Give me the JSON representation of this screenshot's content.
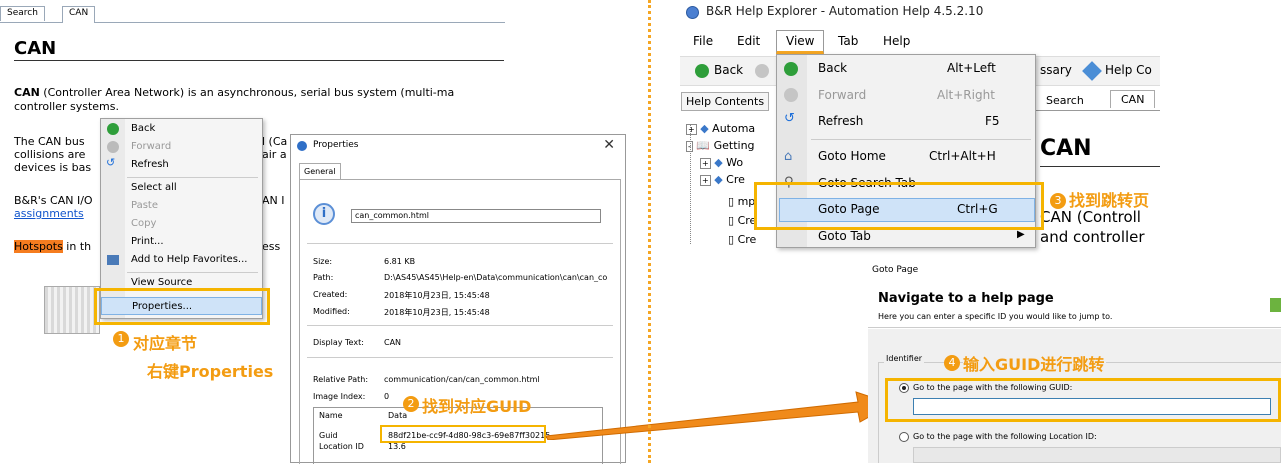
{
  "left": {
    "tabs": [
      "Search",
      "CAN"
    ],
    "heading": "CAN",
    "para1_bold": "CAN",
    "para1_rest": " (Controller Area Network) is an asynchronous, serial bus system (multi-ma",
    "para1_line2": "controller systems.",
    "para2_a": "The CAN bus",
    "para2_b": "collisions are",
    "para2_c": "devices is bas",
    "para2_r1": "l (Ca",
    "para2_r2": "air a",
    "para3_a": "B&R's CAN I/O",
    "para3_b": "assignments",
    "para3_r": "AN I",
    "hotspots": "Hotspots",
    "hotspots_rest": " in th",
    "hotspots_r": "ess",
    "context_menu": [
      {
        "label": "Back",
        "enabled": true
      },
      {
        "label": "Forward",
        "enabled": false
      },
      {
        "label": "Refresh",
        "enabled": true
      },
      {
        "label": "Select all",
        "enabled": true
      },
      {
        "label": "Paste",
        "enabled": false
      },
      {
        "label": "Copy",
        "enabled": false
      },
      {
        "label": "Print...",
        "enabled": true
      },
      {
        "label": "Add to Help Favorites...",
        "enabled": true
      },
      {
        "label": "View Source",
        "enabled": true
      },
      {
        "label": "Properties...",
        "enabled": true
      }
    ],
    "ann1_line1": "对应章节",
    "ann1_line2": "右键Properties",
    "ann1_num": "1"
  },
  "properties": {
    "title": "Properties",
    "tab": "General",
    "filename": "can_common.html",
    "size_label": "Size:",
    "size_value": "6.81 KB",
    "path_label": "Path:",
    "path_value": "D:\\AS45\\AS45\\Help-en\\Data\\communication\\can\\can_co",
    "created_label": "Created:",
    "created_value": "2018年10月23日, 15:45:48",
    "modified_label": "Modified:",
    "modified_value": "2018年10月23日, 15:45:48",
    "display_label": "Display Text:",
    "display_value": "CAN",
    "relpath_label": "Relative Path:",
    "relpath_value": "communication/can/can_common.html",
    "index_label": "Image Index:",
    "index_value": "0",
    "col_name": "Name",
    "col_data": "Data",
    "guid_label": "Guid",
    "guid_value": "88df21be-cc9f-4d80-98c3-69e87ff30215",
    "loc_label": "Location ID",
    "loc_value": "13.6",
    "ann2_num": "2",
    "ann2": "找到对应GUID"
  },
  "right": {
    "app_title": "B&R Help Explorer - Automation Help 4.5.2.10",
    "menubar": [
      "File",
      "Edit",
      "View",
      "Tab",
      "Help"
    ],
    "toolbar_back": "Back",
    "toolbar_ssary": "ssary",
    "toolbar_helpco": "Help Co",
    "help_contents": "Help Contents",
    "tabs": [
      "Search",
      "CAN"
    ],
    "tree": [
      "Automa",
      "Getting",
      "Wo",
      "Cre",
      "mp",
      "Cre",
      "Cre"
    ],
    "can_heading": "CAN",
    "can_text1": "CAN (Controll",
    "can_text2": "and controller",
    "view_menu": [
      {
        "label": "Back",
        "shortcut": "Alt+Left",
        "enabled": true
      },
      {
        "label": "Forward",
        "shortcut": "Alt+Right",
        "enabled": false
      },
      {
        "label": "Refresh",
        "shortcut": "F5",
        "enabled": true
      },
      {
        "label": "Goto Home",
        "shortcut": "Ctrl+Alt+H",
        "enabled": true
      },
      {
        "label": "Goto Search Tab",
        "shortcut": "",
        "enabled": true
      },
      {
        "label": "Goto Page",
        "shortcut": "Ctrl+G",
        "enabled": true
      },
      {
        "label": "Goto Tab",
        "shortcut": "",
        "enabled": true
      }
    ],
    "ann3_num": "3",
    "ann3": "找到跳转页"
  },
  "goto": {
    "window_title": "Goto Page",
    "heading": "Navigate to a help page",
    "sub": "Here you can enter a specific ID you would like to jump to.",
    "group": "Identifier",
    "opt1": "Go to the page with the following GUID:",
    "opt2": "Go to the page with the following Location ID:",
    "guid_input": "",
    "ann4_num": "4",
    "ann4": "输入GUID进行跳转"
  }
}
